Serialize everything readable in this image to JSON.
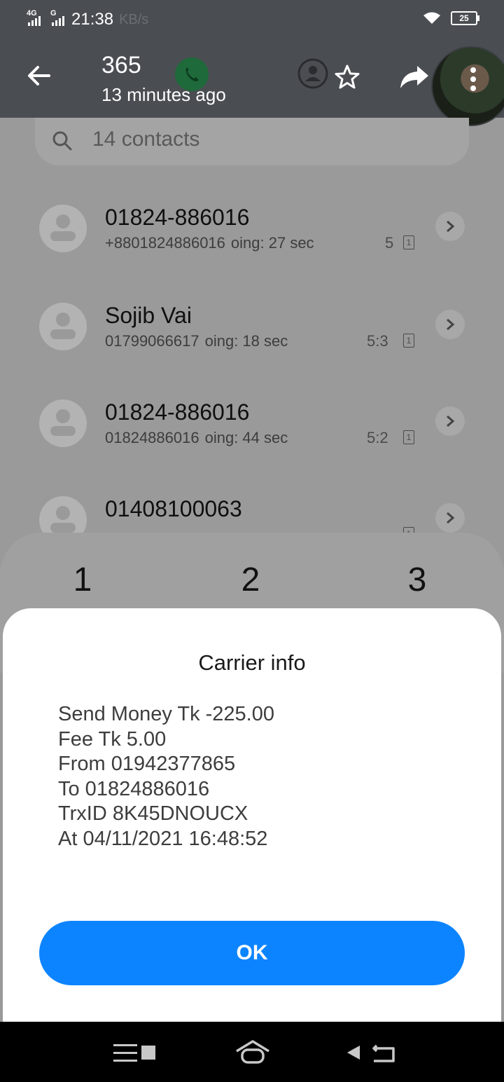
{
  "status_bar": {
    "time": "21:38",
    "net1": "4G",
    "net2": "G",
    "speed_ghost": "KB/s",
    "battery": "25"
  },
  "header": {
    "title": "365",
    "subtitle": "13 minutes ago"
  },
  "search": {
    "placeholder": "14 contacts"
  },
  "call_log": [
    {
      "name": "01824-886016",
      "number": "+8801824886016",
      "detail": "oing: 27 sec",
      "time": "5",
      "sim": "1"
    },
    {
      "name": "Sojib Vai",
      "number": "01799066617",
      "detail": "oing: 18 sec",
      "time": "5:3",
      "sim": "1"
    },
    {
      "name": "01824-886016",
      "number": "01824886016",
      "detail": "oing: 44 sec",
      "time": "5:2",
      "sim": "1"
    },
    {
      "name": "01408100063",
      "number": "",
      "detail": "",
      "time": "",
      "sim": "1"
    }
  ],
  "dialpad": {
    "keys": [
      "1",
      "2",
      "3"
    ]
  },
  "dialog": {
    "title": "Carrier info",
    "lines": [
      "Send Money Tk -225.00",
      "Fee Tk 5.00",
      "From 01942377865",
      "To 01824886016",
      "TrxID 8K45DNOUCX",
      "At 04/11/2021 16:48:52"
    ],
    "ok_label": "OK"
  },
  "colors": {
    "accent": "#0d84ff",
    "header_bg": "#4a4d52",
    "dim_bg": "#9a9a9a"
  },
  "icons": [
    "back-arrow-icon",
    "phone-icon",
    "contact-icon",
    "star-icon",
    "share-icon",
    "more-icon",
    "search-icon",
    "chevron-right-icon",
    "menu-icon",
    "home-icon",
    "back-icon"
  ]
}
